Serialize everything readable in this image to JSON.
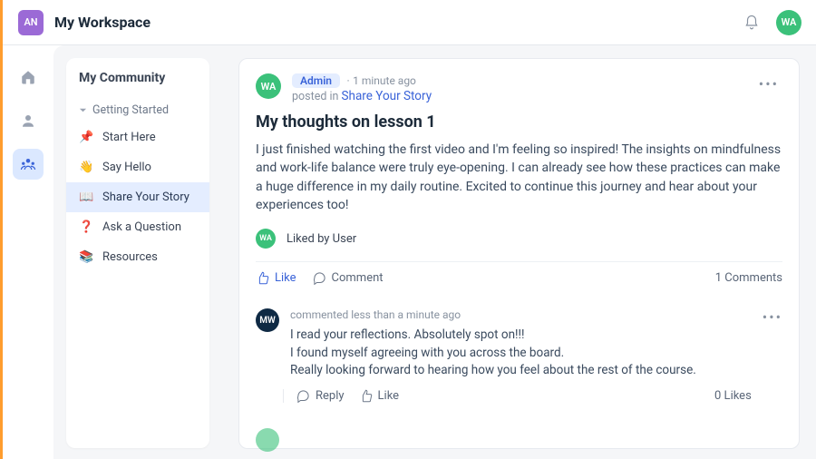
{
  "topbar": {
    "workspace_badge": "AN",
    "workspace_title": "My Workspace",
    "user_avatar": "WA"
  },
  "rail": {
    "items": [
      {
        "name": "home",
        "active": false
      },
      {
        "name": "profile",
        "active": false
      },
      {
        "name": "community",
        "active": true
      }
    ]
  },
  "side": {
    "title": "My Community",
    "group_label": "Getting Started",
    "items": [
      {
        "emoji": "📌",
        "label": "Start Here"
      },
      {
        "emoji": "👋",
        "label": "Say Hello"
      },
      {
        "emoji": "📖",
        "label": "Share Your Story"
      },
      {
        "emoji": "❓",
        "label": "Ask a Question"
      },
      {
        "emoji": "📚",
        "label": "Resources"
      }
    ]
  },
  "post": {
    "author_avatar": "WA",
    "badge": "Admin",
    "time_sep": "·",
    "time": "1 minute ago",
    "posted_in_prefix": "posted in ",
    "posted_in_topic": "Share Your Story",
    "title": "My thoughts on lesson 1",
    "body": "I just finished watching the first video and I'm feeling so inspired! The insights on mindfulness and work-life balance were truly eye-opening. I can already see how these practices can make a huge difference in my daily routine. Excited to continue this journey and hear about your experiences too!",
    "liked_by_avatar": "WA",
    "liked_by_text": "Liked by User",
    "like_label": "Like",
    "comment_label": "Comment",
    "comments_count": "1 Comments"
  },
  "comment": {
    "avatar": "MW",
    "time": "commented less than a minute ago",
    "body_line1": "I read your reflections. Absolutely spot on!!!",
    "body_line2": "I found myself agreeing with you across the board.",
    "body_line3": "Really looking forward to hearing how you feel about the rest of the course.",
    "reply_label": "Reply",
    "like_label": "Like",
    "likes_count": "0 Likes"
  }
}
